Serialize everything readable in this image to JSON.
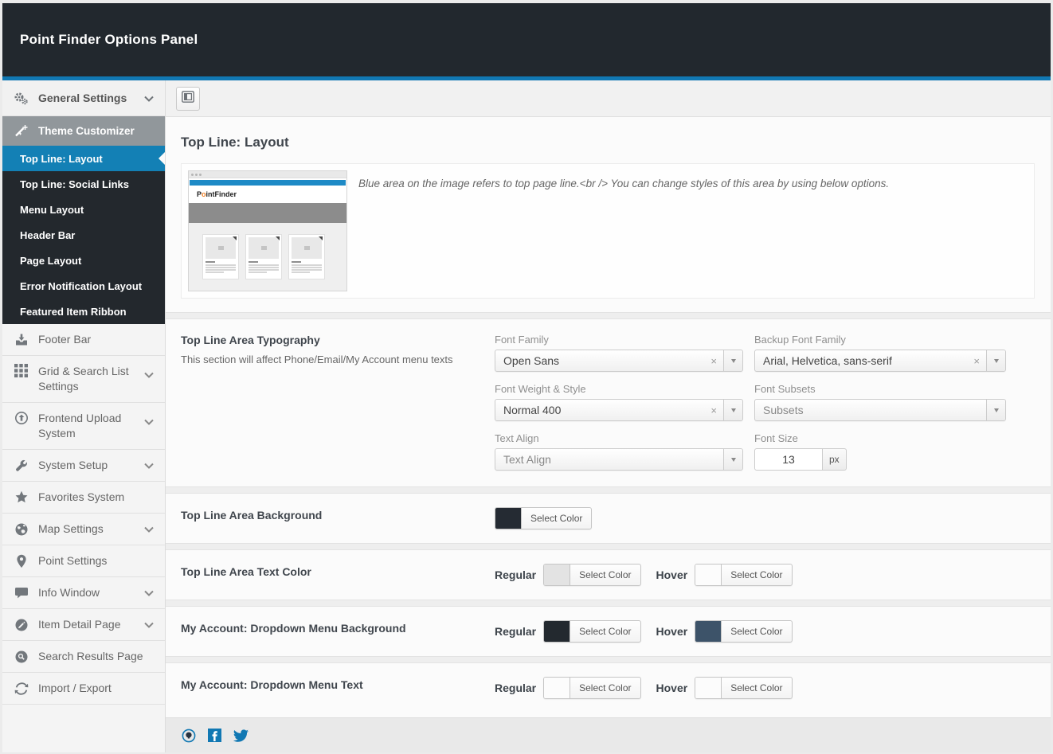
{
  "theme": {
    "accent_blue": "#1380b5",
    "header_bg": "#22282e",
    "sidebar_dark_bg": "#23282d",
    "group_header_gray": "#91979b",
    "social_blue": "#1178b3",
    "preview_topline_blue": "#1e8ac6"
  },
  "header": {
    "title": "Point Finder Options Panel"
  },
  "sidebar": {
    "general": {
      "label": "General Settings"
    },
    "group": {
      "label": "Theme Customizer"
    },
    "submenu": [
      {
        "label": "Top Line: Layout",
        "active": true
      },
      {
        "label": "Top Line: Social Links"
      },
      {
        "label": "Menu Layout"
      },
      {
        "label": "Header Bar"
      },
      {
        "label": "Page Layout"
      },
      {
        "label": "Error Notification Layout"
      },
      {
        "label": "Featured Item Ribbon"
      }
    ],
    "items": [
      {
        "label": "Footer Bar",
        "icon": "download-tray-icon"
      },
      {
        "label": "Grid & Search List Settings",
        "icon": "grid-icon",
        "chevron": true
      },
      {
        "label": "Frontend Upload System",
        "icon": "upload-circle-icon",
        "chevron": true
      },
      {
        "label": "System Setup",
        "icon": "wrench-icon",
        "chevron": true
      },
      {
        "label": "Favorites System",
        "icon": "star-icon"
      },
      {
        "label": "Map Settings",
        "icon": "globe-icon",
        "chevron": true
      },
      {
        "label": "Point Settings",
        "icon": "map-marker-icon"
      },
      {
        "label": "Info Window",
        "icon": "comment-icon",
        "chevron": true
      },
      {
        "label": "Item Detail Page",
        "icon": "edit-circle-icon",
        "chevron": true
      },
      {
        "label": "Search Results Page",
        "icon": "search-circle-icon"
      },
      {
        "label": "Import / Export",
        "icon": "sync-icon"
      }
    ]
  },
  "page": {
    "title": "Top Line: Layout"
  },
  "preview": {
    "description": "Blue area on the image refers to top page line.<br /> You can change styles of this area by using below options.",
    "logo_parts": [
      "P",
      "o",
      "intFinder"
    ]
  },
  "typography": {
    "title": "Top Line Area Typography",
    "description": "This section will affect Phone/Email/My Account menu texts",
    "fields": [
      {
        "label": "Font Family",
        "value": "Open Sans",
        "clearable": true
      },
      {
        "label": "Backup Font Family",
        "value": "Arial, Helvetica, sans-serif",
        "clearable": true
      },
      {
        "label": "Font Weight & Style",
        "value": "Normal 400",
        "clearable": true
      },
      {
        "label": "Font Subsets",
        "value": "Subsets",
        "placeholder": true
      },
      {
        "label": "Text Align",
        "value": "Text Align",
        "placeholder": true
      },
      {
        "label": "Font Size",
        "value": "13",
        "unit": "px"
      }
    ]
  },
  "color_rows": [
    {
      "label": "Top Line Area Background",
      "pickers": [
        {
          "name": "",
          "color": "#252b33"
        }
      ]
    },
    {
      "label": "Top Line Area Text Color",
      "pickers": [
        {
          "name": "Regular",
          "color": "#e3e3e3"
        },
        {
          "name": "Hover",
          "color": "#fcfcfc"
        }
      ]
    },
    {
      "label": "My Account: Dropdown Menu Background",
      "pickers": [
        {
          "name": "Regular",
          "color": "#23292f"
        },
        {
          "name": "Hover",
          "color": "#3d5369"
        }
      ]
    },
    {
      "label": "My Account: Dropdown Menu Text",
      "pickers": [
        {
          "name": "Regular",
          "color": "#fcfcfc"
        },
        {
          "name": "Hover",
          "color": "#fcfcfc"
        }
      ]
    }
  ],
  "buttons": {
    "select_color": "Select Color"
  },
  "icons": {
    "gears-icon": "two cog wheels",
    "wand-icon": "magic wand with sparkles",
    "chevron-down-icon": "v chevron",
    "panel-toggle-icon": "framed layout square",
    "download-tray-icon": "arrow down into tray",
    "grid-icon": "3x3 square grid",
    "upload-circle-icon": "arrow up inside circle",
    "wrench-icon": "wrench",
    "star-icon": "★",
    "globe-icon": "earth globe",
    "map-marker-icon": "location pin",
    "comment-icon": "speech bubble",
    "edit-circle-icon": "pencil inside circle",
    "search-circle-icon": "magnifier inside circle",
    "sync-icon": "circular arrows",
    "clear-x-icon": "×",
    "dropdown-arrow-icon": "▾",
    "image-placeholder-icon": "small picture glyph",
    "social-circle-icon": "round logo in ring",
    "facebook-icon": "facebook f square",
    "twitter-icon": "twitter bird"
  }
}
